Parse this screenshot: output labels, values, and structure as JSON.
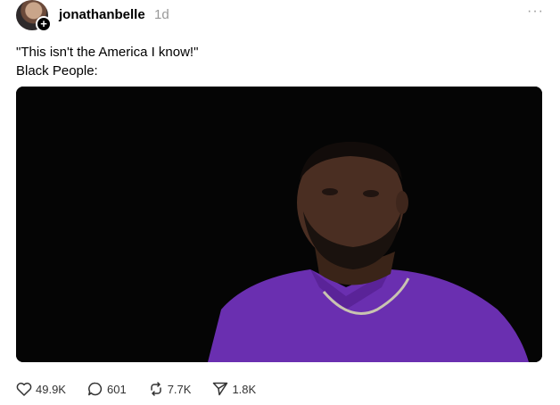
{
  "post": {
    "username": "jonathanbelle",
    "timestamp": "1d",
    "more_label": "···",
    "text_lines": [
      "\"This isn't the America I know!\"",
      "Black People:"
    ]
  },
  "actions": {
    "likes": "49.9K",
    "replies": "601",
    "reposts": "7.7K",
    "shares": "1.8K"
  },
  "icons": {
    "follow": "plus-icon",
    "like": "heart-icon",
    "reply": "speech-bubble-icon",
    "repost": "repost-arrows-icon",
    "share": "send-icon"
  },
  "colors": {
    "text": "#000000",
    "muted": "#999999",
    "media_bg": "#050505",
    "shirt": "#6a2fb0"
  }
}
